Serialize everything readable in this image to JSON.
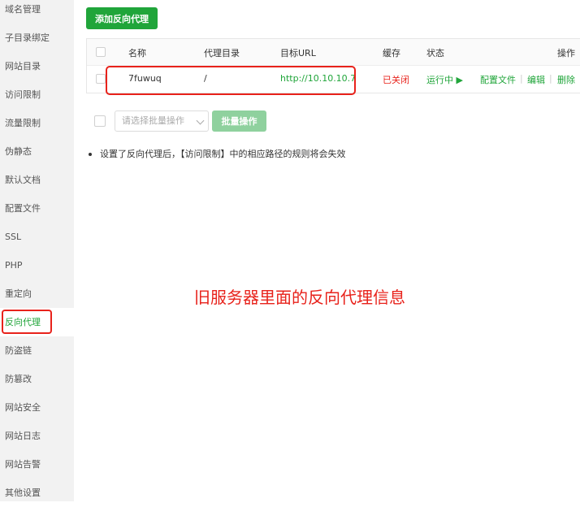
{
  "sidebar": {
    "items": [
      {
        "label": "域名管理"
      },
      {
        "label": "子目录绑定"
      },
      {
        "label": "网站目录"
      },
      {
        "label": "访问限制"
      },
      {
        "label": "流量限制"
      },
      {
        "label": "伪静态"
      },
      {
        "label": "默认文档"
      },
      {
        "label": "配置文件"
      },
      {
        "label": "SSL"
      },
      {
        "label": "PHP"
      },
      {
        "label": "重定向"
      },
      {
        "label": "反向代理",
        "active": true
      },
      {
        "label": "防盗链"
      },
      {
        "label": "防篡改"
      },
      {
        "label": "网站安全"
      },
      {
        "label": "网站日志"
      },
      {
        "label": "网站告警"
      },
      {
        "label": "其他设置"
      }
    ]
  },
  "toolbar": {
    "add_label": "添加反向代理"
  },
  "table": {
    "headers": {
      "name": "名称",
      "dir": "代理目录",
      "url": "目标URL",
      "cache": "缓存",
      "status": "状态",
      "actions": "操作"
    },
    "rows": [
      {
        "name": "7fuwuq",
        "dir": "/",
        "url": "http://10.10.10.7",
        "cache": "已关闭",
        "status": "运行中 ▶",
        "config": "配置文件",
        "edit": "编辑",
        "delete": "删除"
      }
    ],
    "separator": "|"
  },
  "batch": {
    "placeholder": "请选择批量操作",
    "button": "批量操作"
  },
  "note": "设置了反向代理后，【访问限制】中的相应路径的规则将会失效",
  "annotation": "旧服务器里面的反向代理信息",
  "colors": {
    "accent": "#20a53a",
    "danger": "#e8221b",
    "sidebar_bg": "#f2f2f2"
  }
}
